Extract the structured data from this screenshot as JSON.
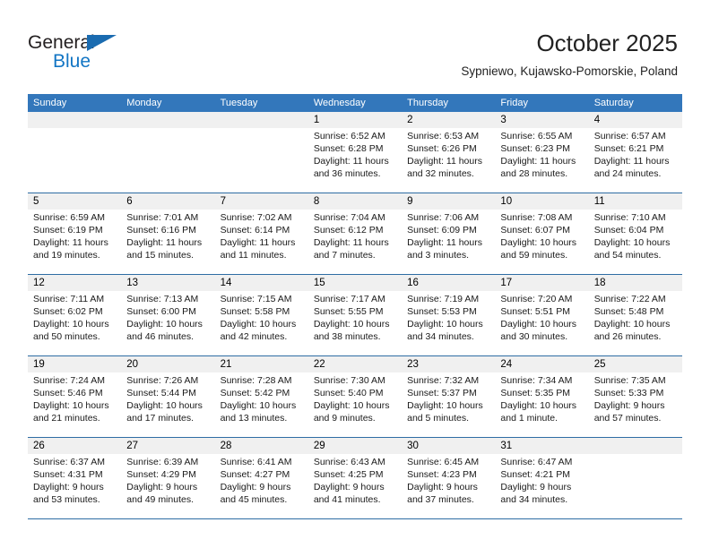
{
  "brand": {
    "name_part1": "General",
    "name_part2": "Blue",
    "triangle_color": "#1a6bb0",
    "blue_color": "#1275c4"
  },
  "header": {
    "month_title": "October 2025",
    "location": "Sypniewo, Kujawsko-Pomorskie, Poland"
  },
  "theme": {
    "header_bar_color": "#3377bb",
    "week_divider_color": "#2e6da4",
    "daynum_band_color": "#f0f0f0"
  },
  "weekdays": [
    "Sunday",
    "Monday",
    "Tuesday",
    "Wednesday",
    "Thursday",
    "Friday",
    "Saturday"
  ],
  "weeks": [
    [
      {
        "day": "",
        "sunrise": "",
        "sunset": "",
        "daylight_line1": "",
        "daylight_line2": ""
      },
      {
        "day": "",
        "sunrise": "",
        "sunset": "",
        "daylight_line1": "",
        "daylight_line2": ""
      },
      {
        "day": "",
        "sunrise": "",
        "sunset": "",
        "daylight_line1": "",
        "daylight_line2": ""
      },
      {
        "day": "1",
        "sunrise": "Sunrise: 6:52 AM",
        "sunset": "Sunset: 6:28 PM",
        "daylight_line1": "Daylight: 11 hours",
        "daylight_line2": "and 36 minutes."
      },
      {
        "day": "2",
        "sunrise": "Sunrise: 6:53 AM",
        "sunset": "Sunset: 6:26 PM",
        "daylight_line1": "Daylight: 11 hours",
        "daylight_line2": "and 32 minutes."
      },
      {
        "day": "3",
        "sunrise": "Sunrise: 6:55 AM",
        "sunset": "Sunset: 6:23 PM",
        "daylight_line1": "Daylight: 11 hours",
        "daylight_line2": "and 28 minutes."
      },
      {
        "day": "4",
        "sunrise": "Sunrise: 6:57 AM",
        "sunset": "Sunset: 6:21 PM",
        "daylight_line1": "Daylight: 11 hours",
        "daylight_line2": "and 24 minutes."
      }
    ],
    [
      {
        "day": "5",
        "sunrise": "Sunrise: 6:59 AM",
        "sunset": "Sunset: 6:19 PM",
        "daylight_line1": "Daylight: 11 hours",
        "daylight_line2": "and 19 minutes."
      },
      {
        "day": "6",
        "sunrise": "Sunrise: 7:01 AM",
        "sunset": "Sunset: 6:16 PM",
        "daylight_line1": "Daylight: 11 hours",
        "daylight_line2": "and 15 minutes."
      },
      {
        "day": "7",
        "sunrise": "Sunrise: 7:02 AM",
        "sunset": "Sunset: 6:14 PM",
        "daylight_line1": "Daylight: 11 hours",
        "daylight_line2": "and 11 minutes."
      },
      {
        "day": "8",
        "sunrise": "Sunrise: 7:04 AM",
        "sunset": "Sunset: 6:12 PM",
        "daylight_line1": "Daylight: 11 hours",
        "daylight_line2": "and 7 minutes."
      },
      {
        "day": "9",
        "sunrise": "Sunrise: 7:06 AM",
        "sunset": "Sunset: 6:09 PM",
        "daylight_line1": "Daylight: 11 hours",
        "daylight_line2": "and 3 minutes."
      },
      {
        "day": "10",
        "sunrise": "Sunrise: 7:08 AM",
        "sunset": "Sunset: 6:07 PM",
        "daylight_line1": "Daylight: 10 hours",
        "daylight_line2": "and 59 minutes."
      },
      {
        "day": "11",
        "sunrise": "Sunrise: 7:10 AM",
        "sunset": "Sunset: 6:04 PM",
        "daylight_line1": "Daylight: 10 hours",
        "daylight_line2": "and 54 minutes."
      }
    ],
    [
      {
        "day": "12",
        "sunrise": "Sunrise: 7:11 AM",
        "sunset": "Sunset: 6:02 PM",
        "daylight_line1": "Daylight: 10 hours",
        "daylight_line2": "and 50 minutes."
      },
      {
        "day": "13",
        "sunrise": "Sunrise: 7:13 AM",
        "sunset": "Sunset: 6:00 PM",
        "daylight_line1": "Daylight: 10 hours",
        "daylight_line2": "and 46 minutes."
      },
      {
        "day": "14",
        "sunrise": "Sunrise: 7:15 AM",
        "sunset": "Sunset: 5:58 PM",
        "daylight_line1": "Daylight: 10 hours",
        "daylight_line2": "and 42 minutes."
      },
      {
        "day": "15",
        "sunrise": "Sunrise: 7:17 AM",
        "sunset": "Sunset: 5:55 PM",
        "daylight_line1": "Daylight: 10 hours",
        "daylight_line2": "and 38 minutes."
      },
      {
        "day": "16",
        "sunrise": "Sunrise: 7:19 AM",
        "sunset": "Sunset: 5:53 PM",
        "daylight_line1": "Daylight: 10 hours",
        "daylight_line2": "and 34 minutes."
      },
      {
        "day": "17",
        "sunrise": "Sunrise: 7:20 AM",
        "sunset": "Sunset: 5:51 PM",
        "daylight_line1": "Daylight: 10 hours",
        "daylight_line2": "and 30 minutes."
      },
      {
        "day": "18",
        "sunrise": "Sunrise: 7:22 AM",
        "sunset": "Sunset: 5:48 PM",
        "daylight_line1": "Daylight: 10 hours",
        "daylight_line2": "and 26 minutes."
      }
    ],
    [
      {
        "day": "19",
        "sunrise": "Sunrise: 7:24 AM",
        "sunset": "Sunset: 5:46 PM",
        "daylight_line1": "Daylight: 10 hours",
        "daylight_line2": "and 21 minutes."
      },
      {
        "day": "20",
        "sunrise": "Sunrise: 7:26 AM",
        "sunset": "Sunset: 5:44 PM",
        "daylight_line1": "Daylight: 10 hours",
        "daylight_line2": "and 17 minutes."
      },
      {
        "day": "21",
        "sunrise": "Sunrise: 7:28 AM",
        "sunset": "Sunset: 5:42 PM",
        "daylight_line1": "Daylight: 10 hours",
        "daylight_line2": "and 13 minutes."
      },
      {
        "day": "22",
        "sunrise": "Sunrise: 7:30 AM",
        "sunset": "Sunset: 5:40 PM",
        "daylight_line1": "Daylight: 10 hours",
        "daylight_line2": "and 9 minutes."
      },
      {
        "day": "23",
        "sunrise": "Sunrise: 7:32 AM",
        "sunset": "Sunset: 5:37 PM",
        "daylight_line1": "Daylight: 10 hours",
        "daylight_line2": "and 5 minutes."
      },
      {
        "day": "24",
        "sunrise": "Sunrise: 7:34 AM",
        "sunset": "Sunset: 5:35 PM",
        "daylight_line1": "Daylight: 10 hours",
        "daylight_line2": "and 1 minute."
      },
      {
        "day": "25",
        "sunrise": "Sunrise: 7:35 AM",
        "sunset": "Sunset: 5:33 PM",
        "daylight_line1": "Daylight: 9 hours",
        "daylight_line2": "and 57 minutes."
      }
    ],
    [
      {
        "day": "26",
        "sunrise": "Sunrise: 6:37 AM",
        "sunset": "Sunset: 4:31 PM",
        "daylight_line1": "Daylight: 9 hours",
        "daylight_line2": "and 53 minutes."
      },
      {
        "day": "27",
        "sunrise": "Sunrise: 6:39 AM",
        "sunset": "Sunset: 4:29 PM",
        "daylight_line1": "Daylight: 9 hours",
        "daylight_line2": "and 49 minutes."
      },
      {
        "day": "28",
        "sunrise": "Sunrise: 6:41 AM",
        "sunset": "Sunset: 4:27 PM",
        "daylight_line1": "Daylight: 9 hours",
        "daylight_line2": "and 45 minutes."
      },
      {
        "day": "29",
        "sunrise": "Sunrise: 6:43 AM",
        "sunset": "Sunset: 4:25 PM",
        "daylight_line1": "Daylight: 9 hours",
        "daylight_line2": "and 41 minutes."
      },
      {
        "day": "30",
        "sunrise": "Sunrise: 6:45 AM",
        "sunset": "Sunset: 4:23 PM",
        "daylight_line1": "Daylight: 9 hours",
        "daylight_line2": "and 37 minutes."
      },
      {
        "day": "31",
        "sunrise": "Sunrise: 6:47 AM",
        "sunset": "Sunset: 4:21 PM",
        "daylight_line1": "Daylight: 9 hours",
        "daylight_line2": "and 34 minutes."
      },
      {
        "day": "",
        "sunrise": "",
        "sunset": "",
        "daylight_line1": "",
        "daylight_line2": ""
      }
    ]
  ]
}
